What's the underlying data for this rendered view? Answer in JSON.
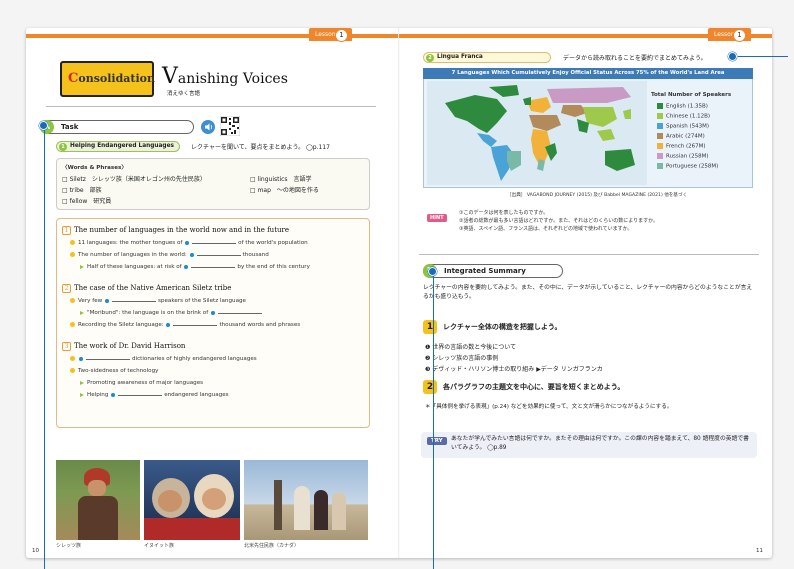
{
  "lesson_tab": {
    "label": "Lesson",
    "number": "1"
  },
  "left_page": {
    "consolidation_label": "Consolidation",
    "title": "Vanishing Voices",
    "subtitle": "消えゆく言語",
    "task": {
      "badge": "A",
      "label": "Task"
    },
    "listening": {
      "number": "1",
      "label": "Helping Endangered Languages",
      "instruction": "レクチャーを聞いて、要点をまとめよう。 ◯p.117"
    },
    "words": {
      "heading": "〈Words & Phrases〉",
      "items": [
        "□ Siletz　シレッツ族（米国オレゴン州の先住民族）",
        "□ linguistics　言語学",
        "□ tribe　部族",
        "□ map　〜の地図を作る",
        "□ fellow　研究員"
      ]
    },
    "sections": [
      {
        "number": "1",
        "title": "The number of languages in the world now and in the future",
        "lines": [
          {
            "kind": "dot",
            "before": "11 languages: the mother tongues of",
            "after": "of the world's population"
          },
          {
            "kind": "dot",
            "before": "The number of languages in the world:",
            "after": "thousand"
          },
          {
            "kind": "tri",
            "before": "Half of these languages: at risk of",
            "after": "by the end of this century"
          }
        ]
      },
      {
        "number": "2",
        "title": "The case of the Native American Siletz tribe",
        "lines": [
          {
            "kind": "dot",
            "before": "Very few",
            "after": "speakers of the Siletz language"
          },
          {
            "kind": "tri",
            "before": "\"Moribund\": the language is on the brink of",
            "after": ""
          },
          {
            "kind": "dot",
            "before": "Recording the Siletz language:",
            "after": "thousand words and phrases"
          }
        ]
      },
      {
        "number": "3",
        "title": "The work of Dr. David Harrison",
        "lines": [
          {
            "kind": "dot",
            "before": "",
            "after": "dictionaries of highly endangered languages"
          },
          {
            "kind": "dot",
            "before": "Two-sidedness of technology",
            "after": ""
          },
          {
            "kind": "tri",
            "before": "Promoting awareness of major languages",
            "after": ""
          },
          {
            "kind": "tri",
            "before": "Helping",
            "after": "endangered languages"
          }
        ]
      }
    ],
    "captions": [
      "シレッツ族",
      "イヌイット族",
      "北米先住民族（カナダ）"
    ],
    "page_number": "10"
  },
  "right_page": {
    "lingua": {
      "number": "2",
      "label": "Lingua Franca",
      "instruction": "データから読み取れることを要約でまとめてみよう。"
    },
    "map_title": "7 Languages Which Cumulatively Enjoy Official Status Across 75% of the World's Land Area",
    "legend_title": "Total Number of Speakers",
    "legend": [
      {
        "label": "English (1.35B)",
        "color": "#2e8b3e"
      },
      {
        "label": "Chinese (1.12B)",
        "color": "#9ec94a"
      },
      {
        "label": "Spanish (543M)",
        "color": "#4aa3d6"
      },
      {
        "label": "Arabic (274M)",
        "color": "#b38a5a"
      },
      {
        "label": "French (267M)",
        "color": "#f2b23a"
      },
      {
        "label": "Russian (258M)",
        "color": "#c89ac4"
      },
      {
        "label": "Portuguese (258M)",
        "color": "#7ab8a8"
      }
    ],
    "source": "［出典］ VAGABOND JOURNEY (2015) 及び Babbel MAGAZINE (2021) 他を基づく",
    "hint_label": "HINT",
    "hints": [
      "①このデータは何を表したものですか。",
      "②話者の総数が最も多い言語はどれですか。また、それはどのくらいの数によりますか。",
      "③英語、スペイン語、フランス語は、それぞれどの地域で使われていますか。"
    ],
    "summary": {
      "badge": "B",
      "label": "Integrated Summary",
      "intro": "レクチャーの内容を要約してみよう。また、その中に、データが示していること、レクチャーの内容からどのようなことが言えるかも盛り込もう。"
    },
    "step1": {
      "number": "1",
      "label": "レクチャー全体の構造を把握しよう。"
    },
    "step1_items": [
      "❶ 世界の言語の数と今後について",
      "❷ シレッツ族の言語の事例",
      "❸ デヴィッド・ハリソン博士の取り組み ▶データ リンガフランカ"
    ],
    "step2": {
      "number": "2",
      "label": "各パラグラフの主題文を中心に、要旨を短くまとめよう。"
    },
    "step2_note": "＊「具体例を挙げる表現」(p.24) などを効果的に使って、文と文が滑らかにつながるようにする。",
    "try_label": "TRY",
    "try_text": "あなたが学んでみたい言語は何ですか。またその理由は何ですか。この課の内容を踏まえて、80 語程度の英語で書いてみよう。 ◯p.89",
    "page_number": "11"
  },
  "colors": {
    "accent": "#f0862b",
    "green": "#8cc63f",
    "yellow": "#f4c21a",
    "pin": "#1a6db5"
  }
}
